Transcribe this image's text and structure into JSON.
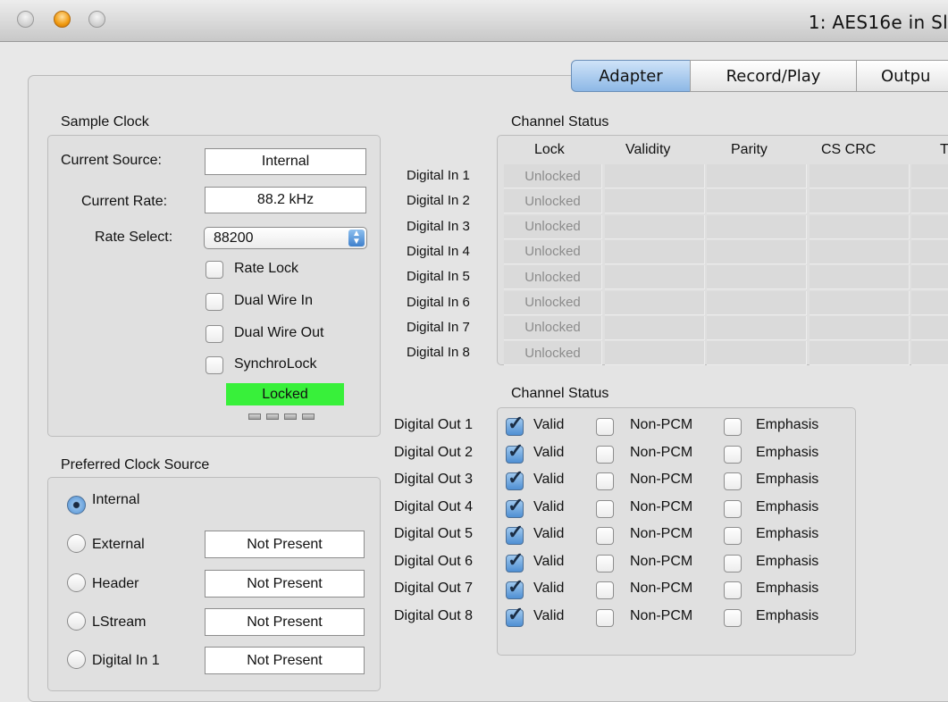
{
  "window": {
    "title": "1: AES16e in Sl"
  },
  "tabs": [
    "Adapter",
    "Record/Play",
    "Outpu"
  ],
  "sample_clock": {
    "title": "Sample Clock",
    "current_source_label": "Current Source:",
    "current_source_value": "Internal",
    "current_rate_label": "Current Rate:",
    "current_rate_value": "88.2 kHz",
    "rate_select_label": "Rate Select:",
    "rate_select_value": "88200",
    "checkboxes": [
      {
        "label": "Rate Lock",
        "checked": false
      },
      {
        "label": "Dual Wire In",
        "checked": false
      },
      {
        "label": "Dual Wire Out",
        "checked": false
      },
      {
        "label": "SynchroLock",
        "checked": false
      }
    ],
    "lock_status": "Locked",
    "lock_color": "#38f03a"
  },
  "preferred_clock": {
    "title": "Preferred Clock Source",
    "options": [
      {
        "label": "Internal",
        "selected": true,
        "status": ""
      },
      {
        "label": "External",
        "selected": false,
        "status": "Not Present"
      },
      {
        "label": "Header",
        "selected": false,
        "status": "Not Present"
      },
      {
        "label": "LStream",
        "selected": false,
        "status": "Not Present"
      },
      {
        "label": "Digital In 1",
        "selected": false,
        "status": "Not Present"
      }
    ]
  },
  "channel_status_in": {
    "title": "Channel Status",
    "columns": [
      "Lock",
      "Validity",
      "Parity",
      "CS CRC",
      "T"
    ],
    "rows": [
      {
        "label": "Digital In 1",
        "lock": "Unlocked"
      },
      {
        "label": "Digital In 2",
        "lock": "Unlocked"
      },
      {
        "label": "Digital In 3",
        "lock": "Unlocked"
      },
      {
        "label": "Digital In 4",
        "lock": "Unlocked"
      },
      {
        "label": "Digital In 5",
        "lock": "Unlocked"
      },
      {
        "label": "Digital In 6",
        "lock": "Unlocked"
      },
      {
        "label": "Digital In 7",
        "lock": "Unlocked"
      },
      {
        "label": "Digital In 8",
        "lock": "Unlocked"
      }
    ]
  },
  "channel_status_out": {
    "title": "Channel Status",
    "option_labels": [
      "Valid",
      "Non-PCM",
      "Emphasis"
    ],
    "rows": [
      {
        "label": "Digital Out 1",
        "valid": true,
        "non_pcm": false,
        "emphasis": false
      },
      {
        "label": "Digital Out 2",
        "valid": true,
        "non_pcm": false,
        "emphasis": false
      },
      {
        "label": "Digital Out 3",
        "valid": true,
        "non_pcm": false,
        "emphasis": false
      },
      {
        "label": "Digital Out 4",
        "valid": true,
        "non_pcm": false,
        "emphasis": false
      },
      {
        "label": "Digital Out 5",
        "valid": true,
        "non_pcm": false,
        "emphasis": false
      },
      {
        "label": "Digital Out 6",
        "valid": true,
        "non_pcm": false,
        "emphasis": false
      },
      {
        "label": "Digital Out 7",
        "valid": true,
        "non_pcm": false,
        "emphasis": false
      },
      {
        "label": "Digital Out 8",
        "valid": true,
        "non_pcm": false,
        "emphasis": false
      }
    ]
  }
}
